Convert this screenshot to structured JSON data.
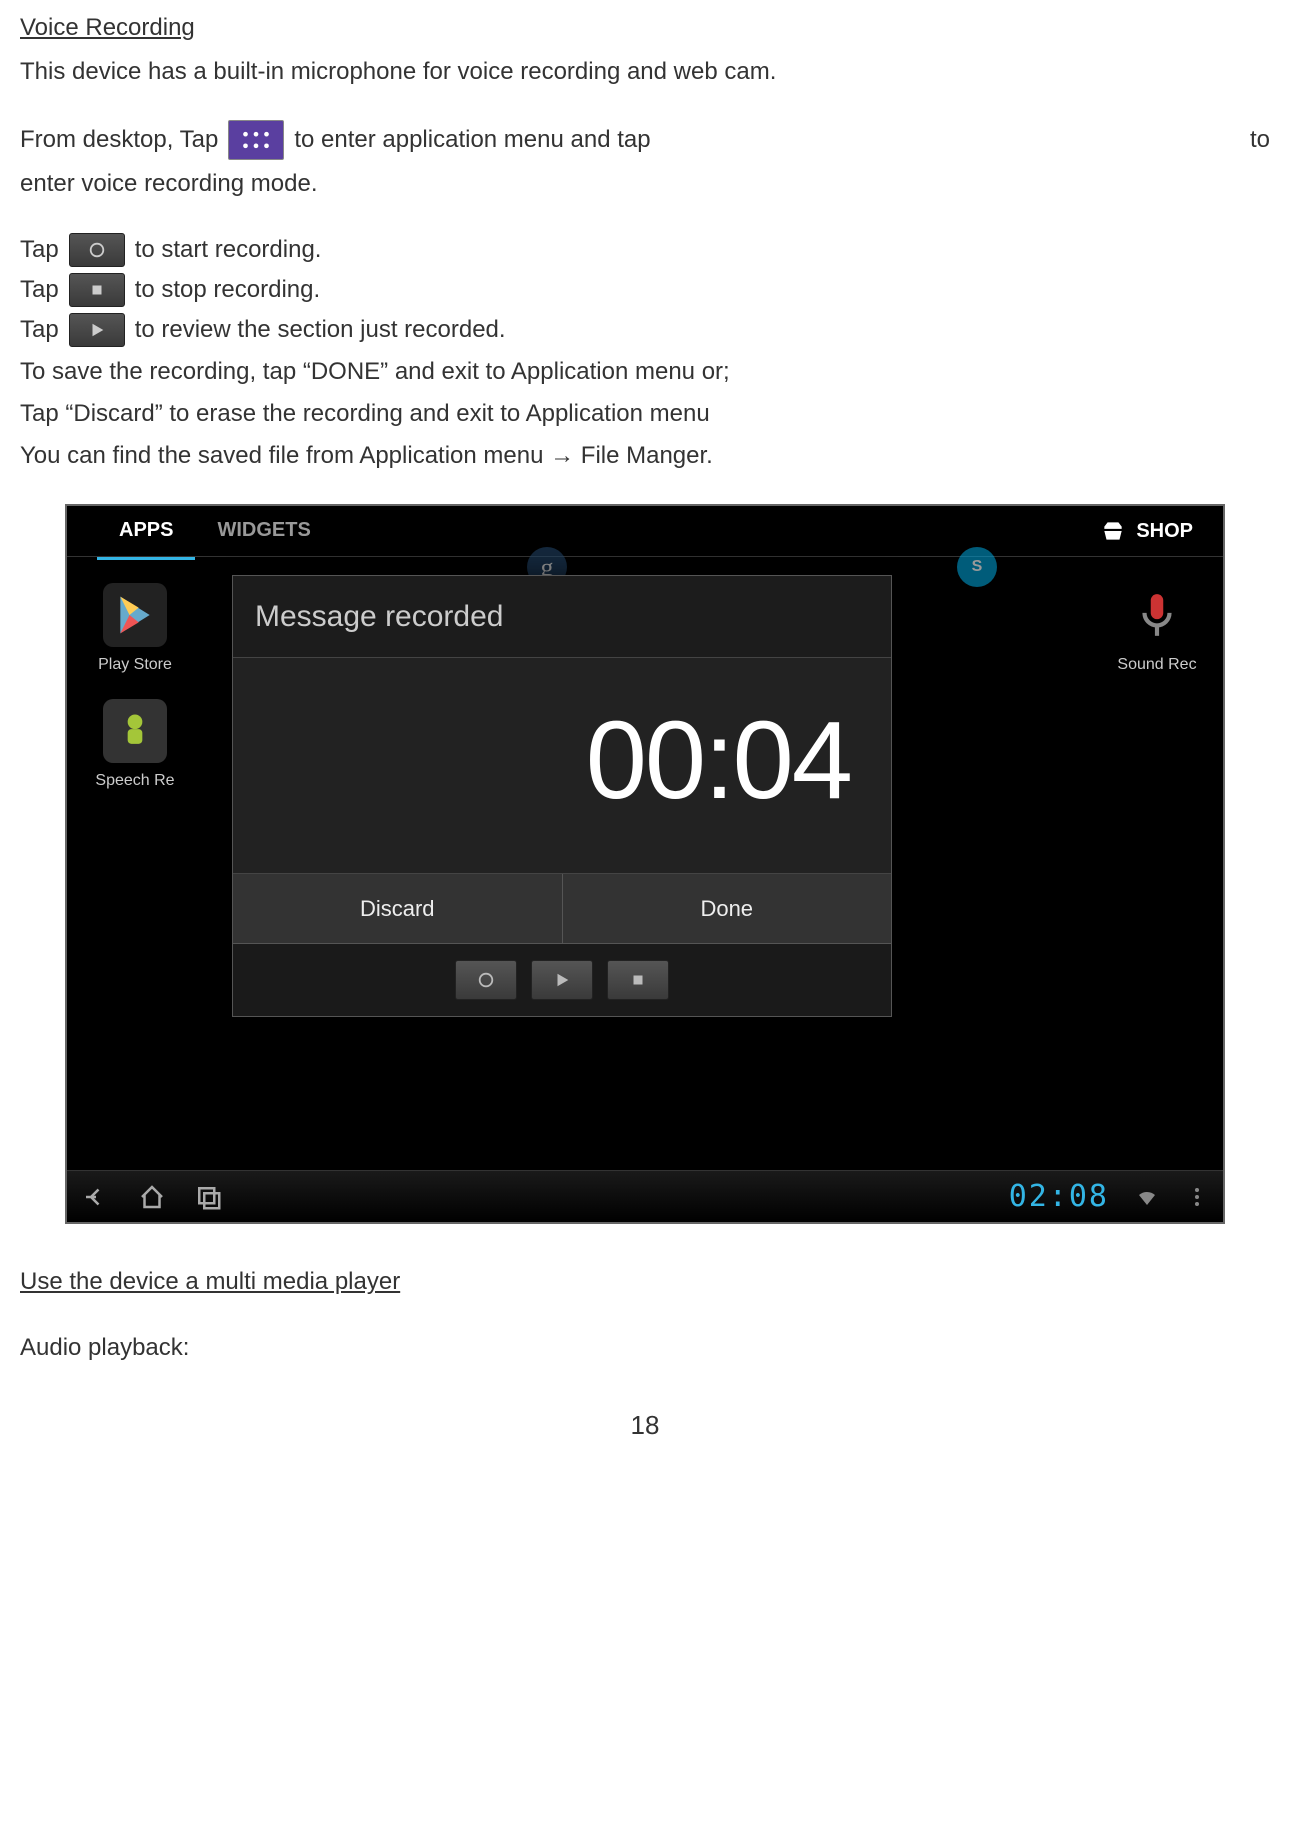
{
  "heading1": "Voice Recording",
  "intro": "This device has a built-in microphone for voice recording and web cam.",
  "step1a": "From desktop, Tap",
  "step1b": "to enter application menu and tap",
  "step1c": "to",
  "step1d": "enter voice recording mode.",
  "tap": "Tap",
  "start": "to start recording.",
  "stop": "to stop recording.",
  "review": "to review the section just recorded.",
  "save1": "To save the recording, tap “DONE” and exit to Application menu or;",
  "save2": "Tap “Discard” to erase the recording and exit to Application menu",
  "save3": "You can find the saved file from Application menu → File Manger.",
  "heading2": "Use the device a multi media player",
  "audio": "Audio playback:",
  "page_number": "18",
  "screenshot": {
    "tabs": {
      "apps": "APPS",
      "widgets": "WIDGETS"
    },
    "shop": "SHOP",
    "apps": {
      "play_store": "Play Store",
      "speech": "Speech Re",
      "sound": "Sound Rec"
    },
    "dialog": {
      "title": "Message recorded",
      "time": "00:04",
      "discard": "Discard",
      "done": "Done"
    },
    "navbar": {
      "clock": "02:08"
    }
  }
}
